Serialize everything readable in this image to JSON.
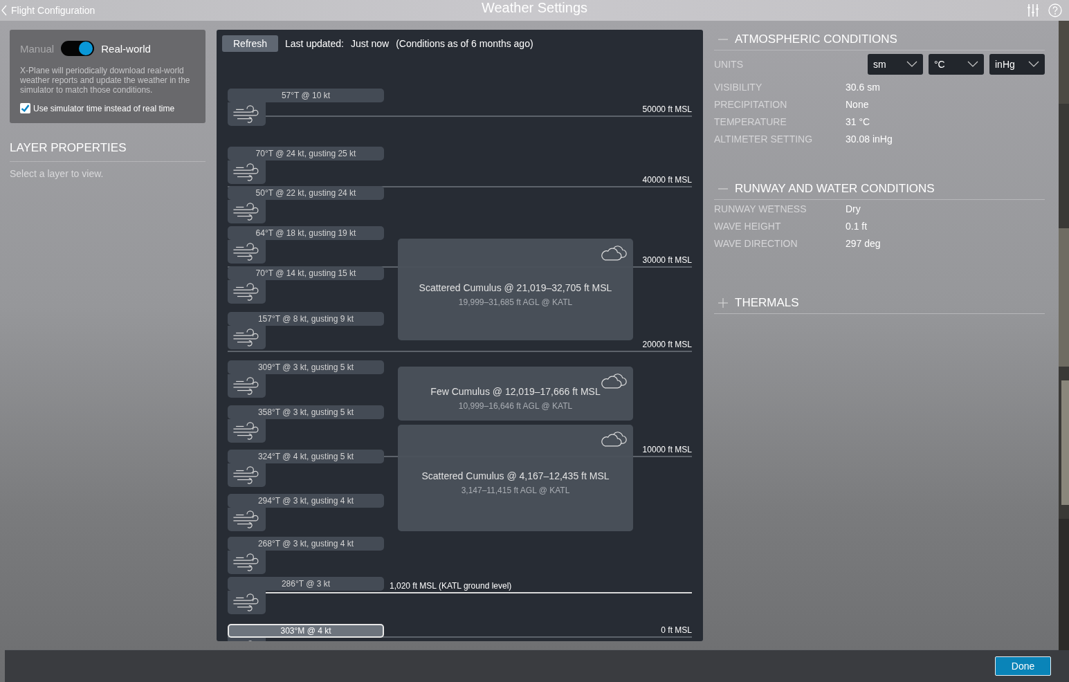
{
  "top_bar": {
    "back_label": "Flight Configuration",
    "title": "Weather Settings"
  },
  "mode": {
    "left_label": "Manual",
    "right_label": "Real-world",
    "real_world": true
  },
  "description": "X-Plane will periodically download real-world weather reports and update the weather in the simulator to match those conditions.",
  "use_sim_time": {
    "label": "Use simulator time instead of real time",
    "checked": true
  },
  "layer_properties": {
    "title": "LAYER PROPERTIES",
    "hint": "Select a layer to view."
  },
  "weather_panel": {
    "refresh": "Refresh",
    "last_updated_label": "Last updated:",
    "last_updated": "Just now",
    "conditions_note": "(Conditions as of 6 months ago)",
    "altitudes": [
      {
        "label": "50000 ft MSL",
        "kind": "level"
      },
      {
        "label": "40000 ft MSL",
        "kind": "level"
      },
      {
        "label": "30000 ft MSL",
        "kind": "level"
      },
      {
        "label": "20000 ft MSL",
        "kind": "level"
      },
      {
        "label": "10000 ft MSL",
        "kind": "level"
      },
      {
        "label": "1,020 ft MSL (KATL ground level)",
        "kind": "ground"
      },
      {
        "label": "0 ft MSL",
        "kind": "level"
      }
    ],
    "wind_layers": [
      {
        "text": "57°T @ 10 kt",
        "selected": false
      },
      {
        "text": "70°T @ 24 kt, gusting 25 kt",
        "selected": false
      },
      {
        "text": "50°T @ 22 kt, gusting 24 kt",
        "selected": false
      },
      {
        "text": "64°T @ 18 kt, gusting 19 kt",
        "selected": false
      },
      {
        "text": "70°T @ 14 kt, gusting 15 kt",
        "selected": false
      },
      {
        "text": "157°T @ 8 kt, gusting 9 kt",
        "selected": false
      },
      {
        "text": "309°T @ 3 kt, gusting 5 kt",
        "selected": false
      },
      {
        "text": "358°T @ 3 kt, gusting 5 kt",
        "selected": false
      },
      {
        "text": "324°T @ 4 kt, gusting 5 kt",
        "selected": false
      },
      {
        "text": "294°T @ 3 kt, gusting 4 kt",
        "selected": false
      },
      {
        "text": "268°T @ 3 kt, gusting 4 kt",
        "selected": false
      },
      {
        "text": "286°T @ 3 kt",
        "selected": false
      },
      {
        "text": "303°M @ 4 kt",
        "selected": true
      }
    ],
    "cloud_layers": [
      {
        "title": "Scattered Cumulus @ 21,019–32,705 ft MSL",
        "subtitle": "19,999–31,685 ft AGL @ KATL"
      },
      {
        "title": "Few Cumulus @ 12,019–17,666 ft MSL",
        "subtitle": "10,999–16,646 ft AGL @ KATL"
      },
      {
        "title": "Scattered Cumulus @ 4,167–12,435 ft MSL",
        "subtitle": "3,147–11,415 ft AGL @ KATL"
      }
    ]
  },
  "sections": [
    {
      "title": "ATMOSPHERIC CONDITIONS",
      "expanded": true,
      "units": {
        "label": "UNITS",
        "values": [
          "sm",
          "°C",
          "inHg"
        ]
      },
      "rows": [
        {
          "label": "VISIBILITY",
          "value": "30.6 sm"
        },
        {
          "label": "PRECIPITATION",
          "value": "None"
        },
        {
          "label": "TEMPERATURE",
          "value": "31 °C"
        },
        {
          "label": "ALTIMETER SETTING",
          "value": "30.08 inHg"
        }
      ]
    },
    {
      "title": "RUNWAY AND WATER CONDITIONS",
      "expanded": true,
      "rows": [
        {
          "label": "RUNWAY WETNESS",
          "value": "Dry"
        },
        {
          "label": "WAVE HEIGHT",
          "value": "0.1 ft"
        },
        {
          "label": "WAVE DIRECTION",
          "value": "297 deg"
        }
      ]
    },
    {
      "title": "THERMALS",
      "expanded": false
    }
  ],
  "done": "Done"
}
